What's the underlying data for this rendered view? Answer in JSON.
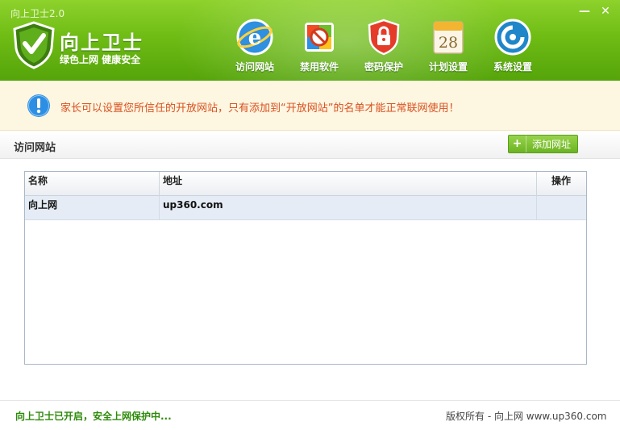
{
  "window": {
    "title": "向上卫士2.0"
  },
  "brand": {
    "name": "向上卫士",
    "slogan": "绿色上网 健康安全"
  },
  "nav": [
    {
      "label": "访问网站",
      "icon": "ie-browser-icon"
    },
    {
      "label": "禁用软件",
      "icon": "blocked-software-icon"
    },
    {
      "label": "密码保护",
      "icon": "padlock-icon"
    },
    {
      "label": "计划设置",
      "icon": "calendar-icon"
    },
    {
      "label": "系统设置",
      "icon": "settings-icon"
    }
  ],
  "calendar_day": "28",
  "notice": {
    "text": "家长可以设置您所信任的开放网站，只有添加到“开放网站”的名单才能正常联网使用！"
  },
  "section": {
    "title": "访问网站",
    "add_button": "添加网址"
  },
  "table": {
    "columns": [
      "名称",
      "地址",
      "操作"
    ],
    "rows": [
      {
        "name": "向上网",
        "address": "up360.com",
        "action": ""
      }
    ]
  },
  "footer": {
    "status": "向上卫士已开启，安全上网保护中...",
    "copyright": "版权所有 - 向上网   www.up360.com"
  }
}
